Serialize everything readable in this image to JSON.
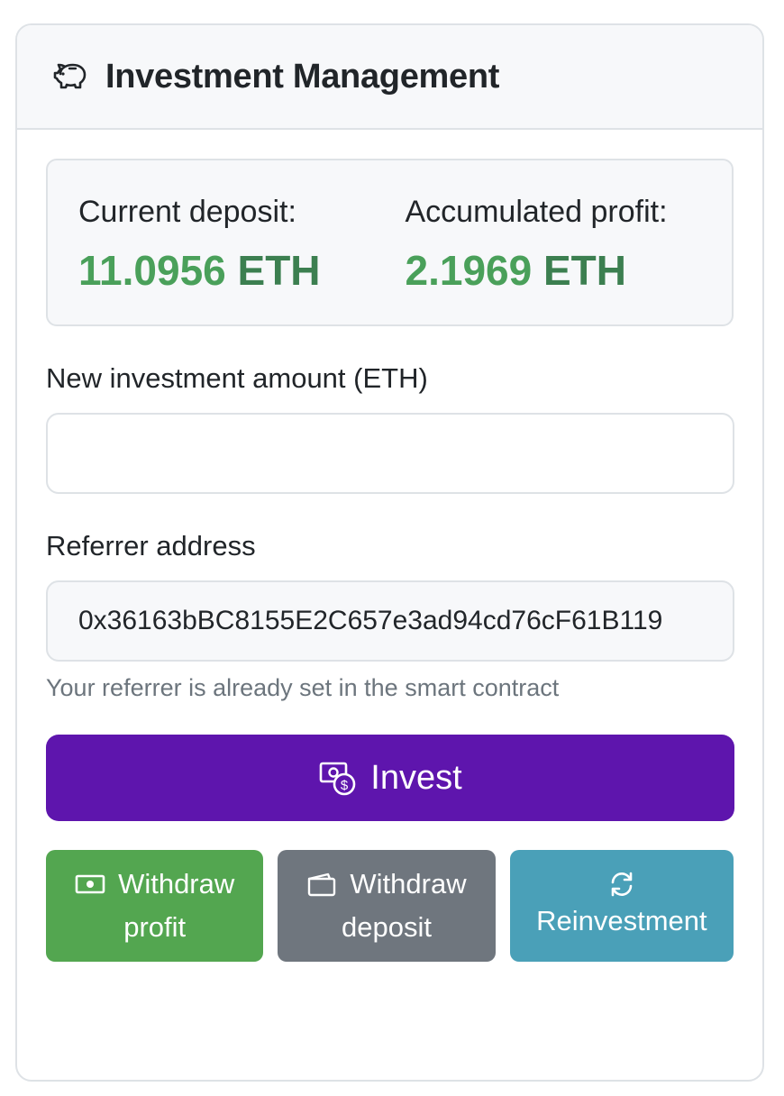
{
  "header": {
    "title": "Investment Management",
    "icon": "piggy-bank-icon"
  },
  "stats": {
    "deposit_label": "Current deposit:",
    "deposit_amount": "11.0956",
    "deposit_unit": "ETH",
    "profit_label": "Accumulated profit:",
    "profit_amount": "2.1969",
    "profit_unit": "ETH"
  },
  "form": {
    "amount_label": "New investment amount (ETH)",
    "amount_value": "",
    "referrer_label": "Referrer address",
    "referrer_value": "0x36163bBC8155E2C657e3ad94cd76cF61B119",
    "referrer_help": "Your referrer is already set in the smart contract"
  },
  "actions": {
    "invest_label": "Invest",
    "withdraw_profit_line1": "Withdraw",
    "withdraw_profit_line2": "profit",
    "withdraw_deposit_line1": "Withdraw",
    "withdraw_deposit_line2": "deposit",
    "reinvestment_label": "Reinvestment"
  },
  "colors": {
    "accent_purple": "#5e15ad",
    "success_green": "#53a650",
    "secondary_gray": "#6f767e",
    "info_teal": "#4aa0b8",
    "value_green": "#4aa05a"
  }
}
